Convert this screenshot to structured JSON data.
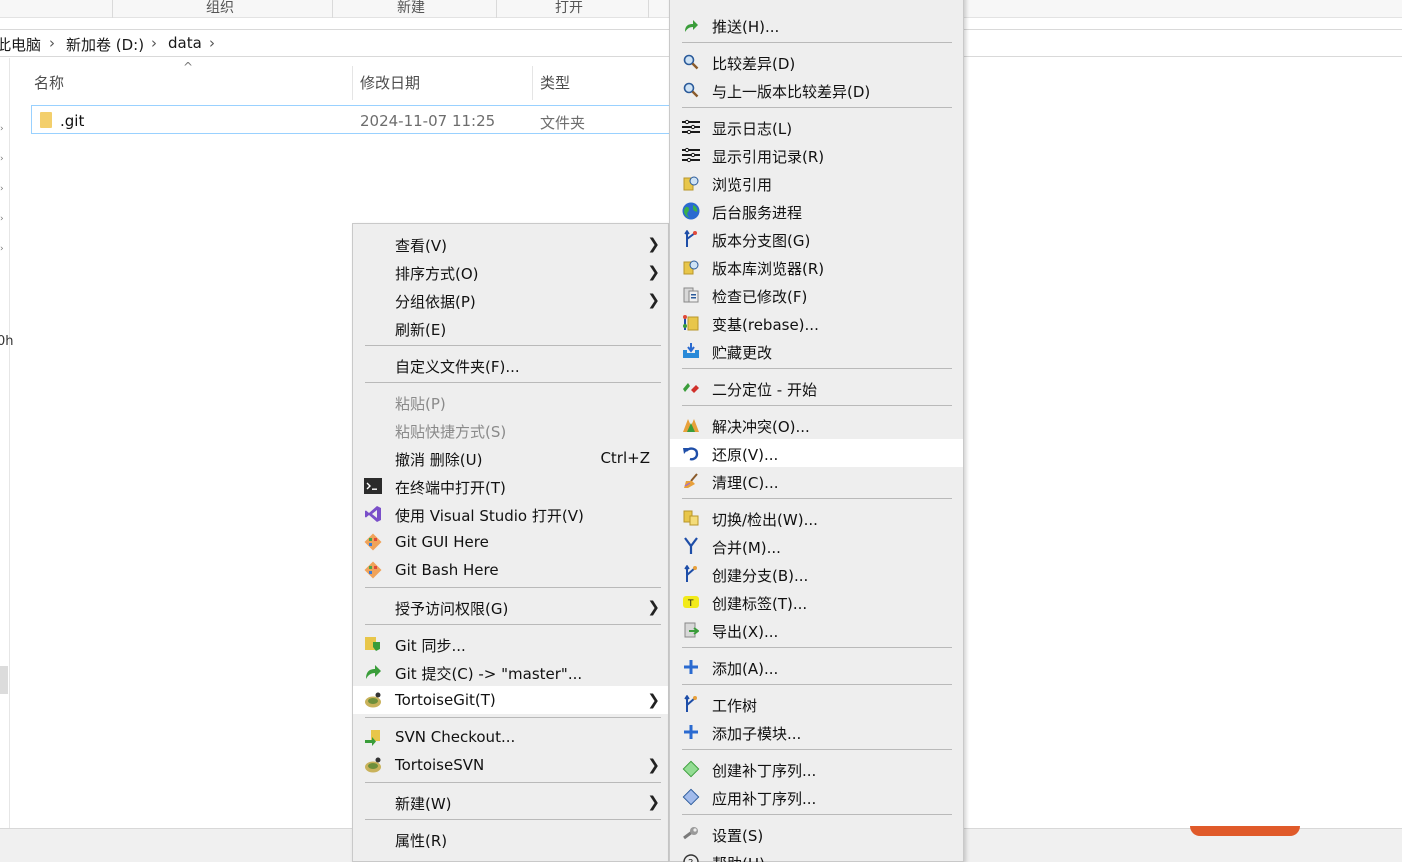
{
  "ribbon": {
    "groups": [
      "组织",
      "新建",
      "打开"
    ]
  },
  "address": {
    "crumbs": [
      "此电脑",
      "新加卷 (D:)",
      "data"
    ]
  },
  "columns": {
    "name": "名称",
    "date": "修改日期",
    "type": "类型"
  },
  "files": [
    {
      "name": ".git",
      "date": "2024-11-07 11:25",
      "type": "文件夹"
    }
  ],
  "left_label": "0h",
  "context_menu": {
    "items": [
      {
        "label": "查看(V)",
        "submenu": true
      },
      {
        "label": "排序方式(O)",
        "submenu": true
      },
      {
        "label": "分组依据(P)",
        "submenu": true
      },
      {
        "label": "刷新(E)"
      },
      {
        "label": "自定义文件夹(F)..."
      },
      {
        "label": "粘贴(P)",
        "disabled": true
      },
      {
        "label": "粘贴快捷方式(S)",
        "disabled": true
      },
      {
        "label": "撤消 删除(U)",
        "shortcut": "Ctrl+Z"
      },
      {
        "label": "在终端中打开(T)",
        "icon": "terminal-icon"
      },
      {
        "label": "使用 Visual Studio 打开(V)",
        "icon": "visual-studio-icon"
      },
      {
        "label": "Git GUI Here",
        "icon": "git-gui-icon"
      },
      {
        "label": "Git Bash Here",
        "icon": "git-bash-icon"
      },
      {
        "label": "授予访问权限(G)",
        "submenu": true
      },
      {
        "label": "Git 同步...",
        "icon": "git-sync-icon"
      },
      {
        "label": "Git 提交(C) -> \"master\"...",
        "icon": "git-commit-icon"
      },
      {
        "label": "TortoiseGit(T)",
        "icon": "tortoisegit-icon",
        "submenu": true,
        "highlighted": true
      },
      {
        "label": "SVN Checkout...",
        "icon": "svn-checkout-icon"
      },
      {
        "label": "TortoiseSVN",
        "icon": "tortoisesvn-icon",
        "submenu": true
      },
      {
        "label": "新建(W)",
        "submenu": true
      },
      {
        "label": "属性(R)"
      }
    ]
  },
  "tortoise_menu": {
    "items": [
      {
        "label": "推送(H)...",
        "icon": "push-icon"
      },
      {
        "label": "比较差异(D)",
        "icon": "diff-icon"
      },
      {
        "label": "与上一版本比较差异(D)",
        "icon": "diff-previous-icon"
      },
      {
        "label": "显示日志(L)",
        "icon": "log-icon"
      },
      {
        "label": "显示引用记录(R)",
        "icon": "reflog-icon"
      },
      {
        "label": "浏览引用",
        "icon": "browse-refs-icon"
      },
      {
        "label": "后台服务进程",
        "icon": "daemon-globe-icon"
      },
      {
        "label": "版本分支图(G)",
        "icon": "revision-graph-icon"
      },
      {
        "label": "版本库浏览器(R)",
        "icon": "repo-browser-icon"
      },
      {
        "label": "检查已修改(F)",
        "icon": "check-modifications-icon"
      },
      {
        "label": "变基(rebase)...",
        "icon": "rebase-icon"
      },
      {
        "label": "贮藏更改",
        "icon": "stash-icon"
      },
      {
        "label": "二分定位 - 开始",
        "icon": "bisect-icon"
      },
      {
        "label": "解决冲突(O)...",
        "icon": "resolve-icon"
      },
      {
        "label": "还原(V)...",
        "icon": "revert-icon",
        "highlighted": true
      },
      {
        "label": "清理(C)...",
        "icon": "cleanup-icon"
      },
      {
        "label": "切换/检出(W)...",
        "icon": "switch-icon"
      },
      {
        "label": "合并(M)...",
        "icon": "merge-icon"
      },
      {
        "label": "创建分支(B)...",
        "icon": "branch-icon"
      },
      {
        "label": "创建标签(T)...",
        "icon": "tag-icon"
      },
      {
        "label": "导出(X)...",
        "icon": "export-icon"
      },
      {
        "label": "添加(A)...",
        "icon": "add-icon"
      },
      {
        "label": "工作树",
        "icon": "worktree-icon"
      },
      {
        "label": "添加子模块...",
        "icon": "add-submodule-icon"
      },
      {
        "label": "创建补丁序列...",
        "icon": "create-patch-icon"
      },
      {
        "label": "应用补丁序列...",
        "icon": "apply-patch-icon"
      },
      {
        "label": "设置(S)",
        "icon": "settings-icon"
      },
      {
        "label": "帮助(H)",
        "icon": "help-icon"
      }
    ]
  }
}
